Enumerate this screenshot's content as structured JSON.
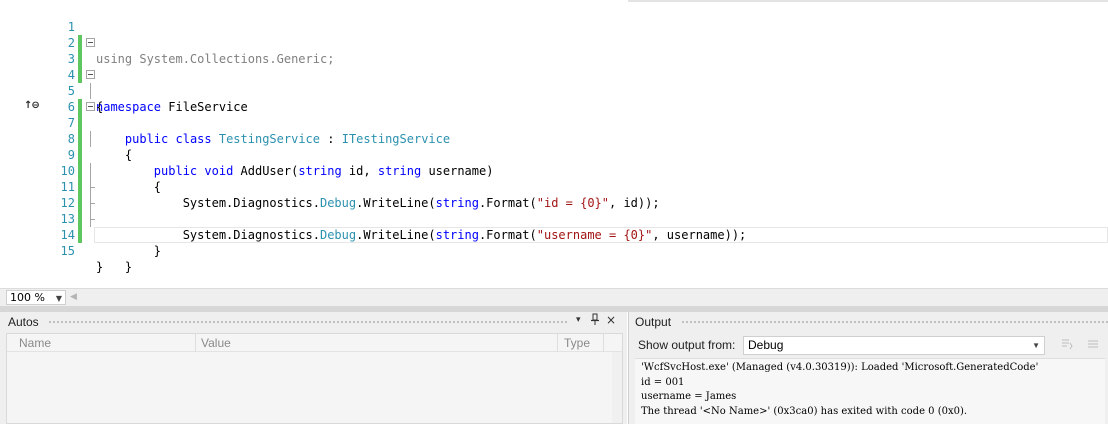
{
  "editor": {
    "code_tokens": {
      "using_kw": "using",
      "using_ns": "System.Collections.Generic;",
      "namespace_kw": "namespace",
      "namespace_name": "FileService",
      "open_brace": "{",
      "close_brace": "}",
      "public_kw": "public",
      "class_kw": "class",
      "class_name": "TestingService",
      "colon": ":",
      "interface_name": "ITestingService",
      "void_kw": "void",
      "method_name": "AddUser(",
      "string_kw": "string",
      "param_id": "id,",
      "param_username": "username)",
      "diag_prefix": "System.Diagnostics.",
      "debug_type": "Debug",
      "writeline": ".WriteLine(",
      "format_call": ".Format(",
      "fmt_id": "\"id = {0}\"",
      "tail_id": ", id));",
      "fmt_username": "\"username = {0}\"",
      "tail_username": ", username));"
    },
    "line_numbers": [
      "1",
      "2",
      "3",
      "4",
      "5",
      "6",
      "7",
      "8",
      "9",
      "10",
      "11",
      "12",
      "13",
      "14",
      "15"
    ],
    "zoom": "100 %"
  },
  "autos": {
    "title": "Autos",
    "columns": [
      "Name",
      "Value",
      "Type"
    ]
  },
  "output": {
    "title": "Output",
    "show_output_label": "Show output from:",
    "show_output_value": "Debug",
    "lines": [
      "'WcfSvcHost.exe' (Managed (v4.0.30319)): Loaded 'Microsoft.GeneratedCode'",
      "id = 001",
      "username = James",
      "The thread '<No Name>' (0x3ca0) has exited with code 0 (0x0)."
    ]
  },
  "colors": {
    "keyword": "#0000ff",
    "type": "#2b91af",
    "string": "#a31515",
    "line_number": "#2b91af",
    "change_bar": "#5fc760"
  },
  "icons": {
    "reference_glyph": "↑⊖",
    "autos_menu": "▾",
    "autos_pin": "📌",
    "autos_close": "×"
  }
}
